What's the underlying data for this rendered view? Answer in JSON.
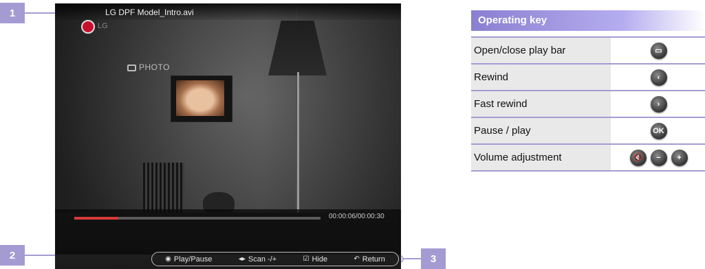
{
  "player": {
    "filename": "LG DPF Model_Intro.avi",
    "logo_text": "LG",
    "photo_label": "PHOTO",
    "progress": 0.18,
    "timecode": "00:00:06/00:00:30",
    "controls": [
      {
        "icon": "circle-icon",
        "glyph": "◉",
        "label": "Play/Pause"
      },
      {
        "icon": "left-right-arrows-icon",
        "glyph": "◂▸",
        "label": "Scan -/+"
      },
      {
        "icon": "checkbox-icon",
        "glyph": "☑",
        "label": "Hide"
      },
      {
        "icon": "return-icon",
        "glyph": "↶",
        "label": "Return"
      }
    ]
  },
  "callouts": [
    "1",
    "2",
    "3"
  ],
  "operating_key": {
    "title": "Operating key",
    "rows": [
      {
        "label": "Open/close play bar",
        "keys": [
          {
            "icon": "playbar-toggle-icon",
            "glyph": "▭"
          }
        ]
      },
      {
        "label": "Rewind",
        "keys": [
          {
            "icon": "chevron-left-icon",
            "glyph": "‹"
          }
        ]
      },
      {
        "label": "Fast rewind",
        "keys": [
          {
            "icon": "chevron-right-icon",
            "glyph": "›"
          }
        ]
      },
      {
        "label": "Pause / play",
        "keys": [
          {
            "icon": "ok-button-icon",
            "glyph": "OK"
          }
        ]
      },
      {
        "label": "Volume adjustment",
        "keys": [
          {
            "icon": "mute-icon",
            "glyph": "🔇"
          },
          {
            "icon": "volume-down-icon",
            "glyph": "−"
          },
          {
            "icon": "volume-up-icon",
            "glyph": "+"
          }
        ]
      }
    ]
  },
  "colors": {
    "accent": "#a49bd3",
    "progress": "#d73a3a",
    "header": "#8a7fd0"
  }
}
